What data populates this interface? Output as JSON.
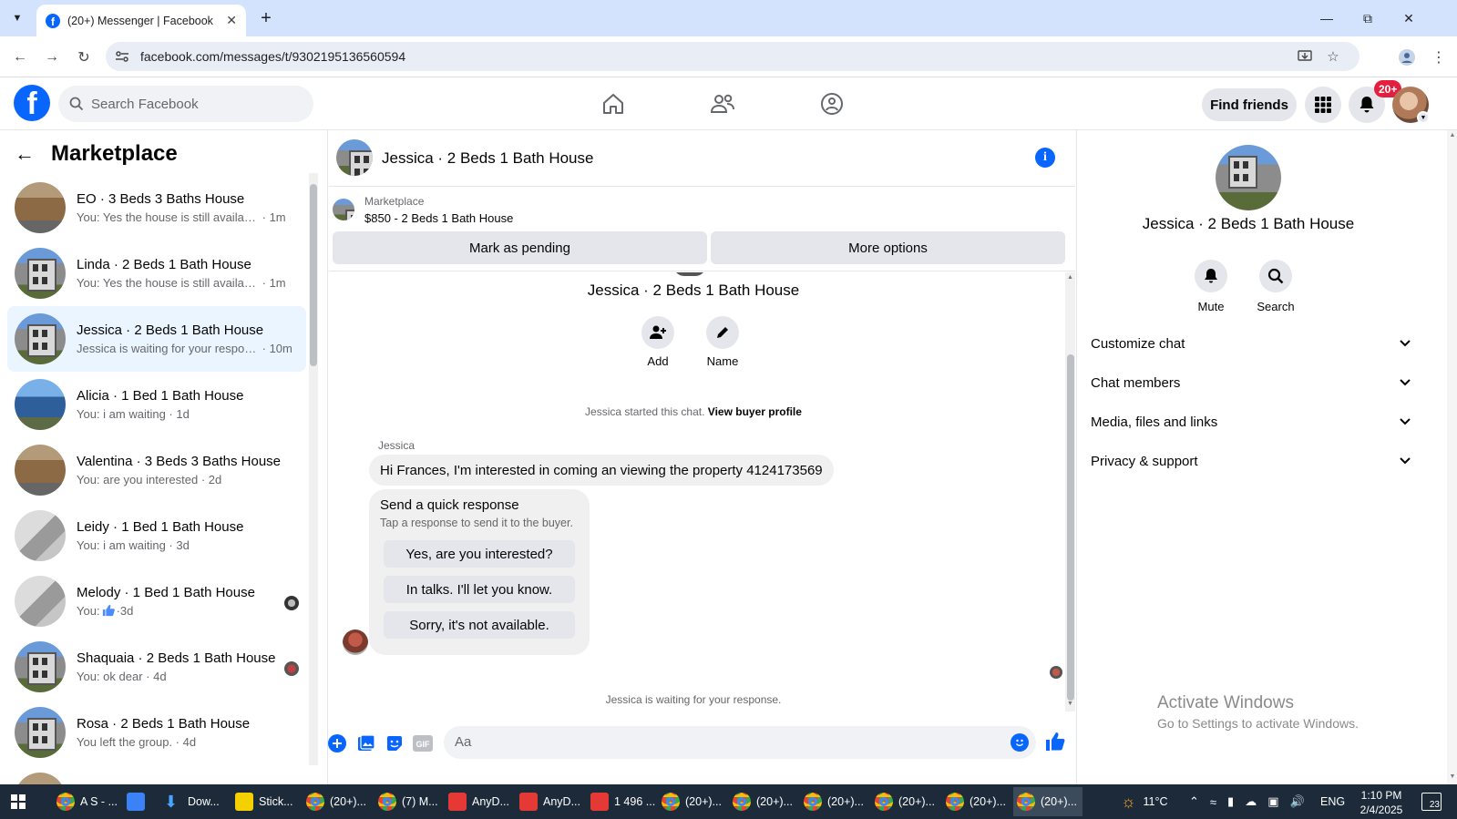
{
  "browser": {
    "tab_title": "(20+) Messenger | Facebook",
    "url": "facebook.com/messages/t/9302195136560594"
  },
  "fb": {
    "search_placeholder": "Search Facebook",
    "find_friends": "Find friends",
    "notification_count": "20+",
    "brand_color": "#0866ff"
  },
  "left": {
    "title": "Marketplace",
    "conversations": [
      {
        "name": "EO · 3 Beds 3 Baths House",
        "snippet": "You: Yes the house is still available ...",
        "time": "1m"
      },
      {
        "name": "Linda · 2 Beds 1 Bath House",
        "snippet": "You: Yes the house is still available ...",
        "time": "1m"
      },
      {
        "name": "Jessica · 2 Beds 1 Bath House",
        "snippet": "Jessica is waiting for your respon...",
        "time": "10m"
      },
      {
        "name": "Alicia · 1 Bed 1 Bath House",
        "snippet": "You: i am waiting",
        "time": "1d"
      },
      {
        "name": "Valentina · 3 Beds 3 Baths House",
        "snippet": "You: are you interested",
        "time": "2d"
      },
      {
        "name": "Leidy · 1 Bed 1 Bath House",
        "snippet": "You: i am waiting",
        "time": "3d"
      },
      {
        "name": "Melody · 1 Bed 1 Bath House",
        "snippet": "You:",
        "time": "3d"
      },
      {
        "name": "Shaquaia · 2 Beds 1 Bath House",
        "snippet": "You: ok dear",
        "time": "4d"
      },
      {
        "name": "Rosa · 2 Beds 1 Bath House",
        "snippet": "You left the group.",
        "time": "4d"
      },
      {
        "name": "",
        "snippet": "",
        "time": ""
      }
    ]
  },
  "chat": {
    "title": "Jessica · 2 Beds 1 Bath House",
    "listing_label": "Marketplace",
    "listing_price": "$850 - 2 Beds 1 Bath House",
    "mark_pending": "Mark as pending",
    "more_options": "More options",
    "intro_name": "Jessica · 2 Beds 1 Bath House",
    "add_label": "Add",
    "name_label": "Name",
    "started_text": "Jessica started this chat.",
    "view_profile": "View buyer profile",
    "sender": "Jessica",
    "message": "Hi Frances, I'm interested in coming an viewing the property 4124173569",
    "quick_title": "Send a quick response",
    "quick_sub": "Tap a response to send it to the buyer.",
    "quick_replies": [
      "Yes, are you interested?",
      "In talks. I'll let you know.",
      "Sorry, it's not available."
    ],
    "waiting": "Jessica is waiting for your response.",
    "composer_placeholder": "Aa"
  },
  "right": {
    "name": "Jessica · 2 Beds 1 Bath House",
    "mute": "Mute",
    "search": "Search",
    "sections": [
      "Customize chat",
      "Chat members",
      "Media, files and links",
      "Privacy & support"
    ],
    "activate_title": "Activate Windows",
    "activate_sub": "Go to Settings to activate Windows."
  },
  "taskbar": {
    "items": [
      "A S - ...",
      "Dow...",
      "Stick...",
      "(20+)...",
      "(7) M...",
      "AnyD...",
      "AnyD...",
      "1 496 ...",
      "(20+)...",
      "(20+)...",
      "(20+)...",
      "(20+)...",
      "(20+)...",
      "(20+)..."
    ],
    "temperature": "11°C",
    "language": "ENG",
    "time": "1:10 PM",
    "date": "2/4/2025",
    "notifications": "23"
  }
}
